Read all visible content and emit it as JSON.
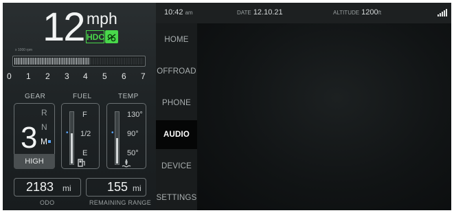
{
  "speed": {
    "value": "12",
    "unit": "mph",
    "hdc": "HDC"
  },
  "rpm": {
    "scale_label": "x 1000 rpm",
    "fill_fraction": 0.58,
    "ticks": [
      "0",
      "1",
      "2",
      "3",
      "4",
      "5",
      "6",
      "7"
    ]
  },
  "gear": {
    "label": "GEAR",
    "current": "3",
    "letters": [
      "R",
      "N",
      "M"
    ],
    "active_letter": "M",
    "mode": "HIGH"
  },
  "fuel": {
    "label": "FUEL",
    "marks": [
      "F",
      "1/2",
      "E"
    ],
    "level": 0.6
  },
  "temp": {
    "label": "TEMP",
    "marks": [
      "130°",
      "90°",
      "50°"
    ],
    "level": 0.5
  },
  "odo": {
    "value": "2183",
    "unit": "mi",
    "label": "ODO"
  },
  "range": {
    "value": "155",
    "unit": "mi",
    "label": "REMAINING RANGE"
  },
  "status": {
    "time": "10:42",
    "ampm": "am",
    "date_label": "DATE",
    "date": "12.10.21",
    "altitude_label": "ALTITUDE",
    "altitude": "1200",
    "altitude_unit": "ft"
  },
  "menu": {
    "items": [
      {
        "label": "HOME"
      },
      {
        "label": "OFFROAD"
      },
      {
        "label": "PHONE"
      },
      {
        "label": "AUDIO"
      },
      {
        "label": "DEVICE"
      },
      {
        "label": "SETTINGS"
      }
    ],
    "active": "AUDIO"
  },
  "colors": {
    "accent_green": "#49d84b",
    "accent_blue": "#5aa6ff"
  }
}
